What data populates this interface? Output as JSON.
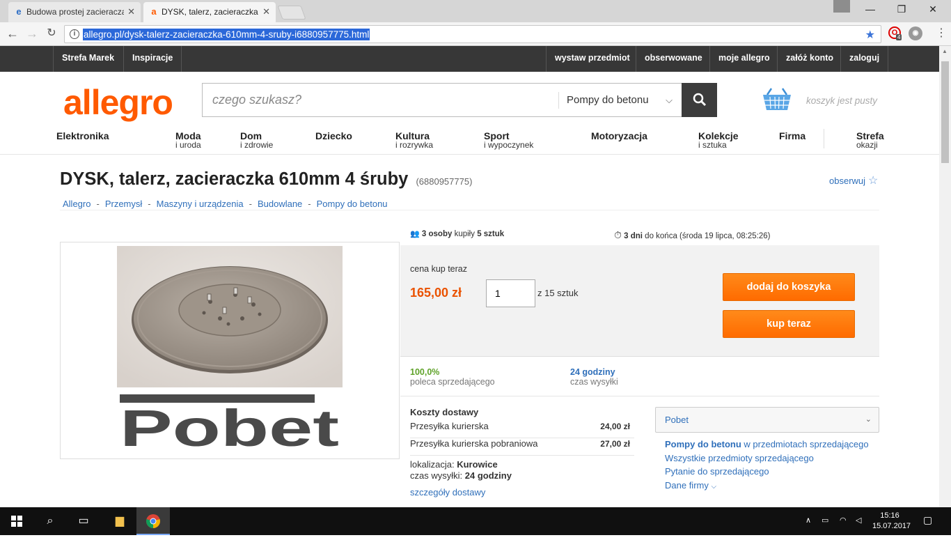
{
  "browser": {
    "tabs": [
      {
        "title": "Budowa prostej zacieracza",
        "icon": "edge-e"
      },
      {
        "title": "DYSK, talerz, zacieraczka",
        "icon": "allegro-a"
      }
    ],
    "url": "allegro.pl/dysk-talerz-zacieraczka-610mm-4-sruby-i6880957775.html",
    "extension_badge": "4"
  },
  "topbar": {
    "left": [
      "Strefa Marek",
      "Inspiracje"
    ],
    "right": [
      "wystaw przedmiot",
      "obserwowane",
      "moje allegro",
      "załóż konto",
      "zaloguj"
    ]
  },
  "header": {
    "logo": "allegro",
    "search_placeholder": "czego szukasz?",
    "search_category": "Pompy do betonu",
    "cart_text": "koszyk jest pusty"
  },
  "categories": [
    {
      "main": "Elektronika",
      "sub": ""
    },
    {
      "main": "Moda",
      "sub": "i uroda"
    },
    {
      "main": "Dom",
      "sub": "i zdrowie"
    },
    {
      "main": "Dziecko",
      "sub": ""
    },
    {
      "main": "Kultura",
      "sub": "i rozrywka"
    },
    {
      "main": "Sport",
      "sub": "i wypoczynek"
    },
    {
      "main": "Motoryzacja",
      "sub": ""
    },
    {
      "main": "Kolekcje",
      "sub": "i sztuka"
    },
    {
      "main": "Firma",
      "sub": ""
    },
    {
      "main": "Strefa",
      "sub": "okazji"
    }
  ],
  "product": {
    "title": "DYSK, talerz, zacieraczka 610mm 4 śruby",
    "id": "(6880957775)",
    "watch": "obserwuj",
    "breadcrumbs": [
      "Allegro",
      "Przemysł",
      "Maszyny i urządzenia",
      "Budowlane",
      "Pompy do betonu"
    ],
    "brand_logo_text": "Pobet"
  },
  "stats": {
    "buyers_count": "3 osoby",
    "buyers_mid": "kupiły",
    "buyers_qty": "5 sztuk",
    "ends_bold": "3 dni",
    "ends_rest": "do końca (środa 19 lipca, 08:25:26)"
  },
  "buy": {
    "price_label": "cena kup teraz",
    "price": "165,00 zł",
    "quantity": "1",
    "of_total": "z 15 sztuk",
    "add_to_cart": "dodaj do koszyka",
    "buy_now": "kup teraz"
  },
  "seller_stats": [
    {
      "value": "100,0%",
      "label": "poleca sprzedającego",
      "color": "#5fa229"
    },
    {
      "value": "24 godziny",
      "label": "czas wysyłki",
      "color": "#2f6fba"
    }
  ],
  "shipping": {
    "heading": "Koszty dostawy",
    "rows": [
      {
        "name": "Przesyłka kurierska",
        "price": "24,00 zł"
      },
      {
        "name": "Przesyłka kurierska pobraniowa",
        "price": "27,00 zł"
      }
    ],
    "location_label": "lokalizacja:",
    "location": "Kurowice",
    "time_label": "czas wysyłki:",
    "time": "24 godziny",
    "details_link": "szczegóły dostawy"
  },
  "seller": {
    "name": "Pobet",
    "link1_bold": "Pompy do betonu",
    "link1_rest": "w przedmiotach sprzedającego",
    "link2": "Wszystkie przedmioty sprzedającego",
    "link3": "Pytanie do sprzedającego",
    "link4": "Dane firmy"
  },
  "taskbar": {
    "time": "15:16",
    "date": "15.07.2017"
  },
  "colors": {
    "brand": "#ff5a00",
    "button": "#ff7a00",
    "link": "#2f6fba"
  }
}
